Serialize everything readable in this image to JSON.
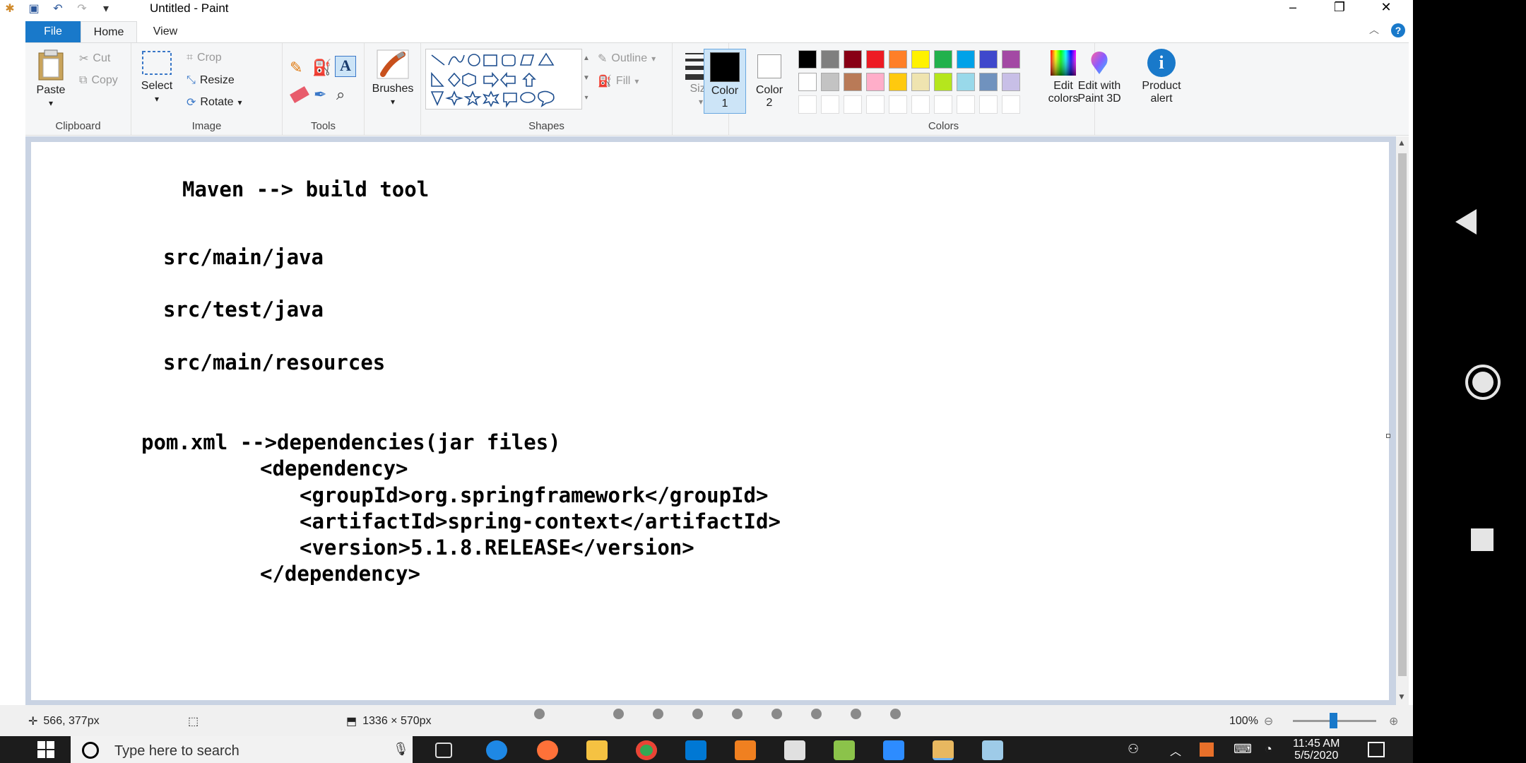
{
  "window": {
    "title": "Untitled - Paint"
  },
  "tabs": [
    {
      "label": "File"
    },
    {
      "label": "Home"
    },
    {
      "label": "View"
    }
  ],
  "ribbon": {
    "clipboard": {
      "paste": "Paste",
      "cut": "Cut",
      "copy": "Copy",
      "label": "Clipboard"
    },
    "image": {
      "select": "Select",
      "crop": "Crop",
      "resize": "Resize",
      "rotate": "Rotate",
      "label": "Image"
    },
    "tools": {
      "label": "Tools"
    },
    "brushes": {
      "label": "Brushes"
    },
    "shapes": {
      "outline": "Outline",
      "fill": "Fill",
      "label": "Shapes"
    },
    "size": {
      "label": "Size"
    },
    "color1": {
      "line1": "Color",
      "line2": "1",
      "value": "#000000"
    },
    "color2": {
      "line1": "Color",
      "line2": "2",
      "value": "#ffffff"
    },
    "colors": {
      "label": "Colors",
      "row1": [
        "#000000",
        "#7f7f7f",
        "#880015",
        "#ed1c24",
        "#ff7f27",
        "#fff200",
        "#22b14c",
        "#00a2e8",
        "#3f48cc",
        "#a349a4"
      ],
      "row2": [
        "#ffffff",
        "#c3c3c3",
        "#b97a57",
        "#ffaec9",
        "#ffc90e",
        "#efe4b0",
        "#b5e61d",
        "#99d9ea",
        "#7092be",
        "#c8bfe7"
      ],
      "row3": [
        "#ffffff",
        "#ffffff",
        "#ffffff",
        "#ffffff",
        "#ffffff",
        "#ffffff",
        "#ffffff",
        "#ffffff",
        "#ffffff",
        "#ffffff"
      ]
    },
    "edit_colors": {
      "line1": "Edit",
      "line2": "colors"
    },
    "paint3d": {
      "line1": "Edit with",
      "line2": "Paint 3D"
    },
    "product_alert": {
      "line1": "Product",
      "line2": "alert"
    }
  },
  "canvas_text": {
    "line1": "Maven --> build tool",
    "line2": "src/main/java",
    "line3": "src/test/java",
    "line4": "src/main/resources",
    "line5": "pom.xml -->dependencies(jar files)",
    "line6": "<dependency>",
    "line7": "<groupId>org.springframework</groupId>",
    "line8": "<artifactId>spring-context</artifactId>",
    "line9": "<version>5.1.8.RELEASE</version>",
    "line10": "</dependency>"
  },
  "statusbar": {
    "cursor_pos": "566, 377px",
    "canvas_size": "1336 × 570px",
    "zoom": "100%"
  },
  "taskbar": {
    "search_placeholder": "Type here to search",
    "time": "11:45 AM",
    "date": "5/5/2020"
  }
}
